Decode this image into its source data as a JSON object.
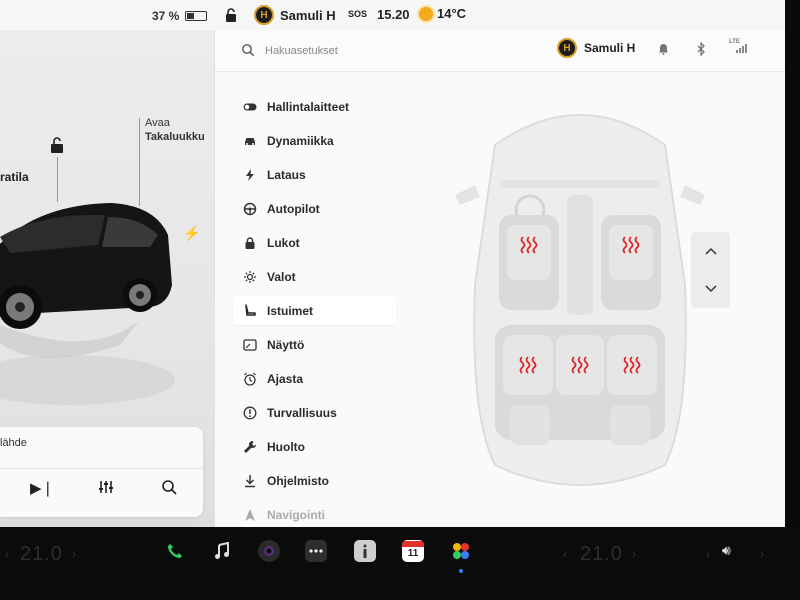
{
  "status": {
    "battery_percent": "37 %",
    "battery_level": 0.37,
    "profile_name": "Samuli H",
    "profile_initials": "H",
    "sos_label": "SOS",
    "time": "15.20",
    "outside_temp": "14°C"
  },
  "car_panel": {
    "trunk_action": "Avaa",
    "trunk_name": "Takaluukku",
    "frunk_label_partial": "ratila",
    "media_source_partial": "lähde"
  },
  "settings": {
    "search_placeholder": "Hakuasetukset",
    "profile_name": "Samuli H",
    "profile_initials": "H",
    "lte_label": "LTE",
    "menu": [
      {
        "label": "Hallintalaitteet",
        "icon": "toggle-icon"
      },
      {
        "label": "Dynamiikka",
        "icon": "car-front-icon"
      },
      {
        "label": "Lataus",
        "icon": "bolt-icon"
      },
      {
        "label": "Autopilot",
        "icon": "steering-wheel-icon"
      },
      {
        "label": "Lukot",
        "icon": "lock-icon"
      },
      {
        "label": "Valot",
        "icon": "light-icon"
      },
      {
        "label": "Istuimet",
        "icon": "seat-icon"
      },
      {
        "label": "Näyttö",
        "icon": "display-icon"
      },
      {
        "label": "Ajasta",
        "icon": "alarm-clock-icon"
      },
      {
        "label": "Turvallisuus",
        "icon": "alert-circle-icon"
      },
      {
        "label": "Huolto",
        "icon": "wrench-icon"
      },
      {
        "label": "Ohjelmisto",
        "icon": "download-icon"
      },
      {
        "label": "Navigointi",
        "icon": "navigation-icon"
      }
    ],
    "active_item": "Istuimet",
    "seat_heaters": {
      "front_left": "on",
      "front_right": "on",
      "rear_left": "on",
      "rear_center": "on",
      "rear_right": "on"
    },
    "heater_color": "#e0252b"
  },
  "dock": {
    "driver_temp": "21.0",
    "passenger_temp": "21.0",
    "calendar_day": "11",
    "apps": [
      "phone-icon",
      "music-icon",
      "camera-icon",
      "more-icon",
      "info-icon",
      "calendar-icon",
      "games-icon"
    ]
  }
}
